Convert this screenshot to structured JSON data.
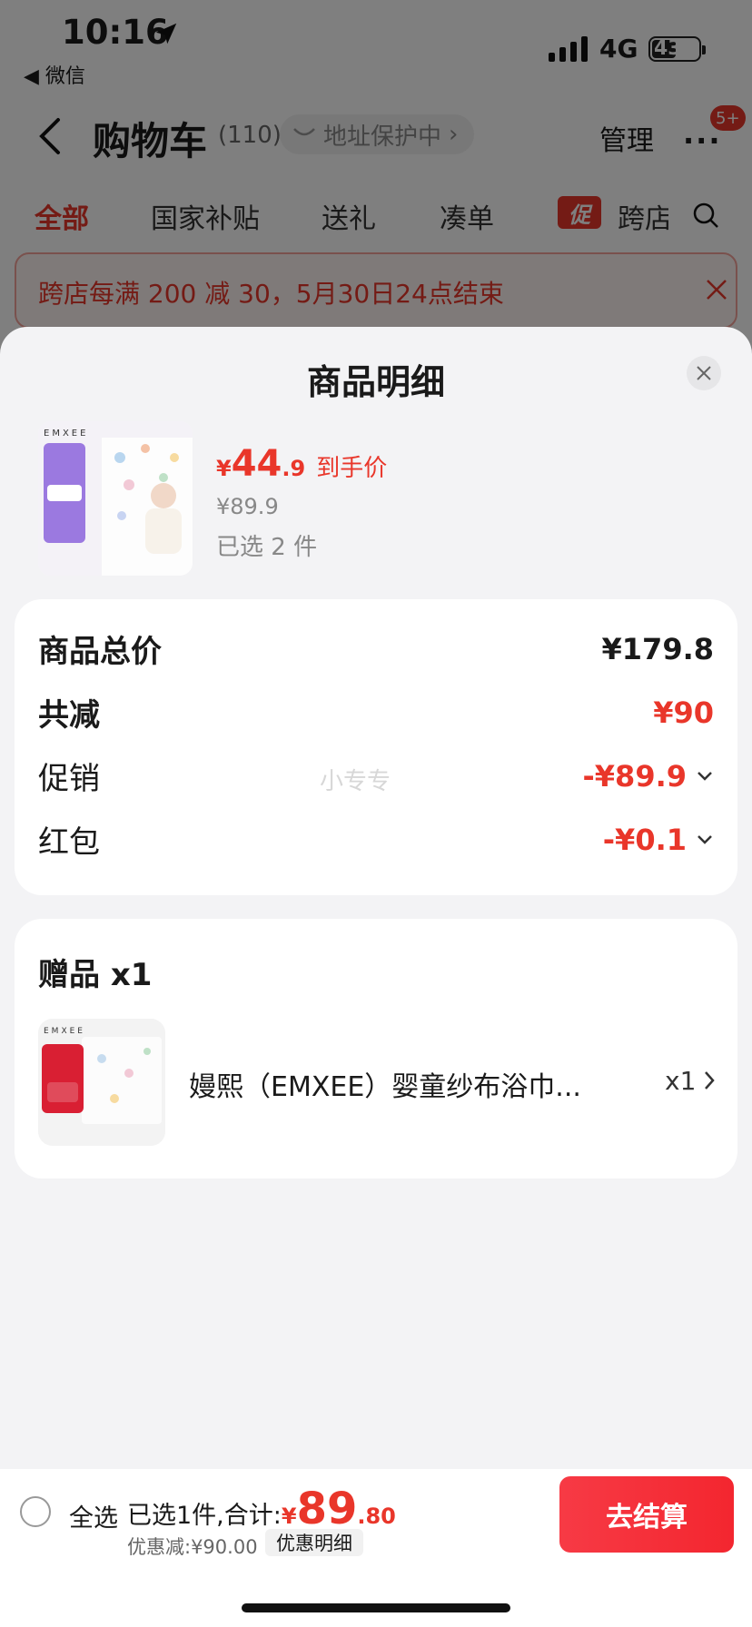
{
  "status_bar": {
    "time": "10:16",
    "back_app": "◀ 微信",
    "network": "4G",
    "battery": "43"
  },
  "header": {
    "title": "购物车",
    "count": "(110)",
    "address_pill": "地址保护中",
    "manage": "管理",
    "more": "···",
    "badge": "5+"
  },
  "tabs": [
    "全部",
    "国家补贴",
    "送礼",
    "凑单",
    "跨店"
  ],
  "promo_tag": "促",
  "banner": {
    "text": "跨店每满 200 减 30，5月30日24点结束"
  },
  "sheet": {
    "title": "商品明细",
    "product": {
      "currency": "¥",
      "price_int": "44",
      "price_dec": ".9",
      "price_label": "到手价",
      "original_price": "¥89.9",
      "selected_count": "已选 2 件"
    },
    "summary": {
      "total_label": "商品总价",
      "total_value": "¥179.8",
      "discount_label": "共减",
      "discount_value": "¥90",
      "promo_label": "促销",
      "promo_value": "-¥89.9",
      "redpack_label": "红包",
      "redpack_value": "-¥0.1",
      "watermark": "小专专"
    },
    "gift": {
      "title": "赠品 x1",
      "name": "嫚熙（EMXEE）婴童纱布浴巾...",
      "qty": "x1"
    }
  },
  "bottom_bar": {
    "select_all": "全选",
    "selected_text": "已选1件,合计:",
    "currency": "¥",
    "total_int": "89",
    "total_dec": ".80",
    "discount_text": "优惠减:¥90.00",
    "discount_detail": "优惠明细",
    "checkout": "去结算"
  },
  "colors": {
    "accent": "#e9362a",
    "checkout": "#f5333f",
    "sheet_bg": "#f3f3f5"
  }
}
